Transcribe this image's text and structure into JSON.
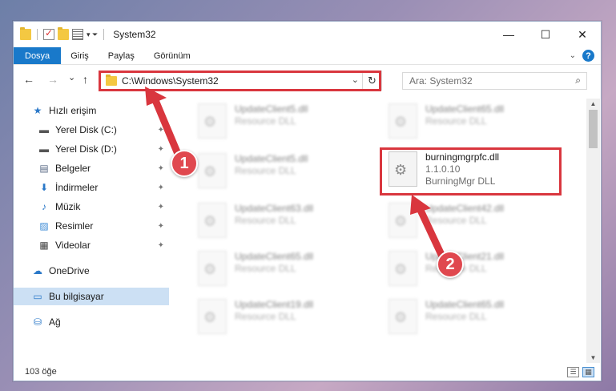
{
  "window": {
    "title": "System32",
    "controls": {
      "minimize": "—",
      "maximize": "☐",
      "close": "✕"
    }
  },
  "ribbon": {
    "tabs": [
      "Dosya",
      "Giriş",
      "Paylaş",
      "Görünüm"
    ],
    "file_tab_color": "#1979ca",
    "help": "?"
  },
  "nav": {
    "back": "←",
    "forward": "→",
    "recent": "⌄",
    "up": "↑",
    "address_path": "C:\\Windows\\System32",
    "address_dropdown": "⌄",
    "refresh": "↻",
    "search_placeholder": "Ara: System32",
    "search_icon": "⌕"
  },
  "sidebar": {
    "items": [
      {
        "label": "Hızlı erişim",
        "icon": "star-icon",
        "glyph": "★",
        "pinned": false
      },
      {
        "label": "Yerel Disk (C:)",
        "icon": "drive-icon",
        "glyph": "▬",
        "pinned": true
      },
      {
        "label": "Yerel Disk (D:)",
        "icon": "drive-icon",
        "glyph": "▬",
        "pinned": true
      },
      {
        "label": "Belgeler",
        "icon": "documents-icon",
        "glyph": "▤",
        "pinned": true
      },
      {
        "label": "İndirmeler",
        "icon": "download-icon",
        "glyph": "⬇",
        "pinned": true
      },
      {
        "label": "Müzik",
        "icon": "music-icon",
        "glyph": "♪",
        "pinned": true
      },
      {
        "label": "Resimler",
        "icon": "pictures-icon",
        "glyph": "▨",
        "pinned": true
      },
      {
        "label": "Videolar",
        "icon": "video-icon",
        "glyph": "▦",
        "pinned": true
      },
      {
        "label": "OneDrive",
        "icon": "cloud-icon",
        "glyph": "☁",
        "pinned": false
      },
      {
        "label": "Bu bilgisayar",
        "icon": "computer-icon",
        "glyph": "▭",
        "pinned": false,
        "selected": true
      },
      {
        "label": "Ağ",
        "icon": "network-icon",
        "glyph": "⛁",
        "pinned": false
      }
    ],
    "pin_glyph": "📌"
  },
  "files": {
    "left_column": [
      {
        "name": "UpdateClient5.dll",
        "type": "Resource DLL"
      },
      {
        "name": "UpdateClient5.dll",
        "type": "Resource DLL"
      },
      {
        "name": "UpdateClient63.dll",
        "type": "Resource DLL"
      },
      {
        "name": "UpdateClient65.dll",
        "type": "Resource DLL"
      },
      {
        "name": "UpdateClient19.dll",
        "type": "Resource DLL"
      }
    ],
    "right_column": [
      {
        "name": "UpdateClient65.dll",
        "type": "Resource DLL"
      },
      {
        "name": "UpdateClient42.dll",
        "type": "Resource DLL"
      },
      {
        "name": "UpdateClient21.dll",
        "type": "Resource DLL"
      },
      {
        "name": "UpdateClient65.dll",
        "type": "Resource DLL"
      }
    ],
    "highlighted": {
      "name": "burningmgrpfc.dll",
      "version": "1.1.0.10",
      "description": "BurningMgr DLL"
    }
  },
  "status": {
    "item_count": "103 öğe"
  },
  "annotations": {
    "step1": "1",
    "step2": "2",
    "color": "#d9363e"
  }
}
